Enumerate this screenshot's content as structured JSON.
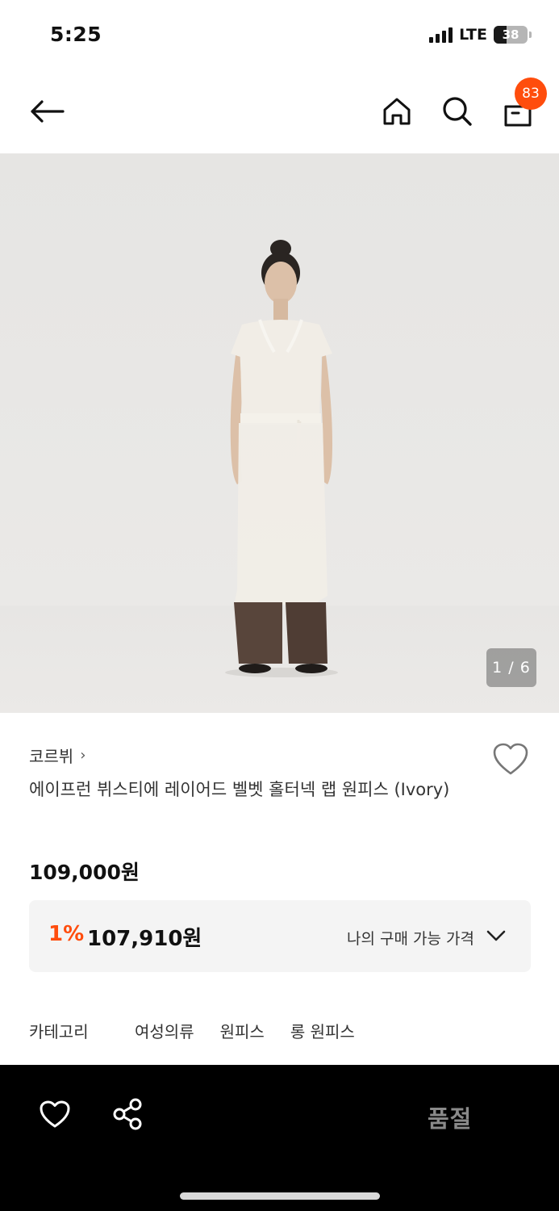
{
  "status_bar": {
    "time": "5:25",
    "network": "LTE",
    "battery": "38",
    "battery_level": 0.38
  },
  "nav": {
    "back_icon": "arrow-left-icon",
    "home_icon": "home-icon",
    "search_icon": "search-icon",
    "bag_icon": "shopping-bag-icon",
    "cart_count": "83"
  },
  "gallery": {
    "page_indicator": "1 / 6"
  },
  "product": {
    "brand": "코르뷔",
    "brand_chevron": "›",
    "title": "에이프런 뷔스티에 레이어드 벨벳 홀터넥 랩 원피스 (Ivory)",
    "price": "109,000원",
    "wish_icon": "heart-outline-icon"
  },
  "benefit": {
    "rate": "1%",
    "price": "107,910원",
    "label": "나의 구매 가능 가격",
    "chevron_icon": "chevron-down-icon"
  },
  "category": {
    "label": "카테고리",
    "items": [
      "여성의류",
      "원피스",
      "롱 원피스"
    ]
  },
  "bottom_bar": {
    "heart_icon": "heart-outline-icon",
    "share_icon": "share-icon",
    "status": "품절"
  },
  "colors": {
    "accent": "#ff4d0d",
    "bottom_bar_bg": "#000000",
    "benefit_bg": "#f4f4f4"
  }
}
